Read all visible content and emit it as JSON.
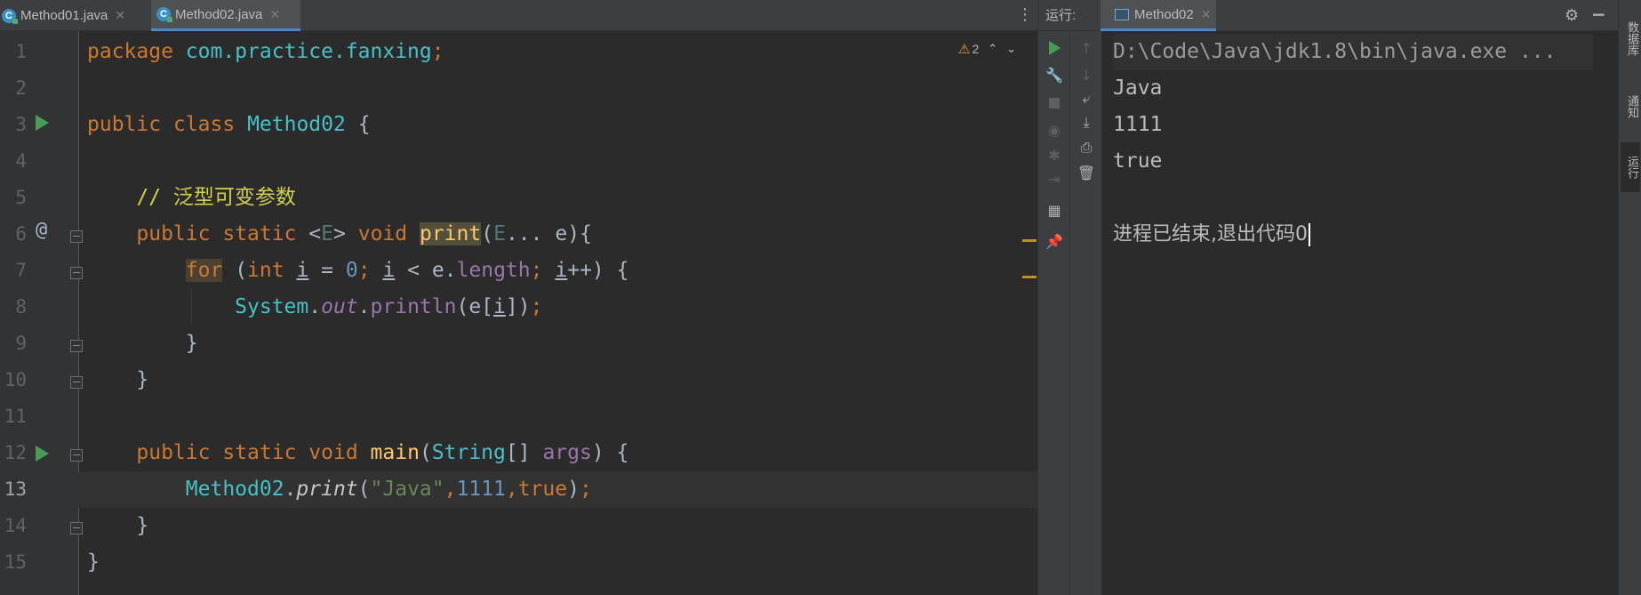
{
  "editor": {
    "tabs": [
      {
        "label": "Method01.java",
        "icon": "java-class-icon"
      },
      {
        "label": "Method02.java",
        "icon": "java-class-icon",
        "active": true
      }
    ],
    "inspection": {
      "warning_count": "2"
    },
    "line_numbers": [
      "1",
      "2",
      "3",
      "4",
      "5",
      "6",
      "7",
      "8",
      "9",
      "10",
      "11",
      "12",
      "13",
      "14",
      "15"
    ],
    "current_line": "13",
    "code": {
      "l1_kw": "package",
      "l1_pkg": "com.practice.fanxing",
      "l1_semi": ";",
      "l3_kw1": "public",
      "l3_kw2": "class",
      "l3_cls": "Method02",
      "l3_brace": "{",
      "l5_comment": "// 泛型可变参数",
      "l6_kw1": "public",
      "l6_kw2": "static",
      "l6_lt": "<",
      "l6_gen": "E",
      "l6_gt": ">",
      "l6_kw3": "void",
      "l6_fn": "print",
      "l6_paren": "(",
      "l6_gen2": "E",
      "l6_rest": "... e){",
      "l7_for": "for",
      "l7_p1": "(",
      "l7_int": "int",
      "l7_i1": "i",
      "l7_eq": " = ",
      "l7_zero": "0",
      "l7_semi1": ";",
      "l7_i2": "i",
      "l7_lt": " < e.",
      "l7_len": "length",
      "l7_semi2": ";",
      "l7_i3": "i",
      "l7_end": "++) {",
      "l8_cls": "System",
      "l8_dot1": ".",
      "l8_out": "out",
      "l8_dot2": ".",
      "l8_fn": "println",
      "l8_p1": "(e[",
      "l8_i": "i",
      "l8_p2": "])",
      "l8_semi": ";",
      "l9_brace": "}",
      "l10_brace": "}",
      "l12_kw1": "public",
      "l12_kw2": "static",
      "l12_kw3": "void",
      "l12_fn": "main",
      "l12_p1": "(",
      "l12_cls": "String",
      "l12_arr": "[] ",
      "l12_args": "args",
      "l12_end": ") {",
      "l13_cls": "Method02",
      "l13_dot": ".",
      "l13_fn": "print",
      "l13_p1": "(",
      "l13_str": "\"Java\"",
      "l13_c1": ",",
      "l13_num": "1111",
      "l13_c2": ",",
      "l13_true": "true",
      "l13_p2": ")",
      "l13_semi": ";",
      "l14_brace": "}",
      "l15_brace": "}"
    }
  },
  "run": {
    "label": "运行:",
    "tab": "Method02",
    "console": {
      "command": "D:\\Code\\Java\\jdk1.8\\bin\\java.exe ...",
      "outputs": [
        "Java",
        "1111",
        "true"
      ],
      "exit_message": "进程已结束,退出代码0"
    }
  },
  "side_tabs": [
    "数据库",
    "通知",
    "运行"
  ],
  "colors": {
    "keyword": "#cc7832",
    "class": "#48c0c7",
    "comment": "#d2d24a",
    "number": "#6897bb",
    "string": "#6a8759",
    "function": "#ffc66d",
    "run_green": "#499c54",
    "accent_blue": "#4a88c7"
  }
}
